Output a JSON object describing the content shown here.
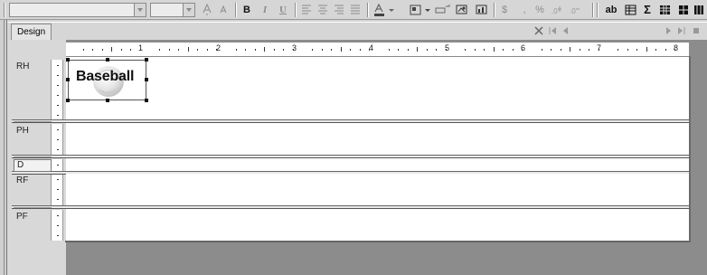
{
  "toolbar": {
    "bold_label": "B",
    "italic_label": "I",
    "underline_label": "U",
    "percent_label": "%",
    "comma_label": ",",
    "currency_label": "$",
    "textbox_label": "ab",
    "sum_label": "Σ"
  },
  "tabs": {
    "design_label": "Design"
  },
  "ruler": {
    "inch_marks": [
      "1",
      "2",
      "3",
      "4",
      "5",
      "6",
      "7",
      "8"
    ]
  },
  "bands": {
    "rh_label": "RH",
    "ph_label": "PH",
    "d_label": "D",
    "rf_label": "RF",
    "pf_label": "PF"
  },
  "picture_control": {
    "text": "Baseball"
  },
  "icons": [
    "font-grow-icon",
    "font-shrink-icon",
    "align-left-icon",
    "align-center-icon",
    "align-right-icon",
    "justify-icon",
    "font-color-icon",
    "fill-color-icon",
    "border-icon",
    "insert-image-icon",
    "chart-icon",
    "textbox-icon",
    "grid-icon",
    "sum-icon",
    "table-icon",
    "close-icon",
    "first-page-icon",
    "prev-page-icon",
    "next-page-icon",
    "last-page-icon",
    "stop-icon"
  ]
}
